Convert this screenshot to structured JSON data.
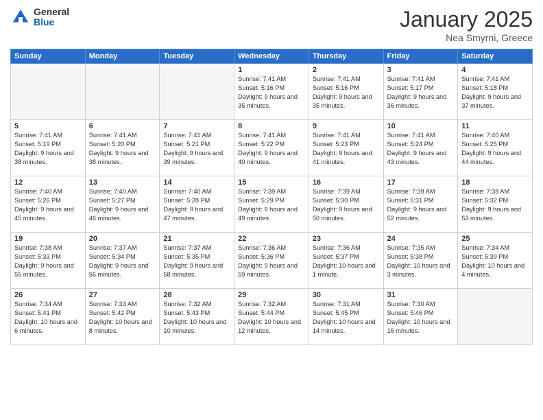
{
  "header": {
    "logo_general": "General",
    "logo_blue": "Blue",
    "title": "January 2025",
    "subtitle": "Nea Smyrni, Greece"
  },
  "days_of_week": [
    "Sunday",
    "Monday",
    "Tuesday",
    "Wednesday",
    "Thursday",
    "Friday",
    "Saturday"
  ],
  "weeks": [
    [
      {
        "day": "",
        "info": ""
      },
      {
        "day": "",
        "info": ""
      },
      {
        "day": "",
        "info": ""
      },
      {
        "day": "1",
        "info": "Sunrise: 7:41 AM\nSunset: 5:16 PM\nDaylight: 9 hours and 35 minutes."
      },
      {
        "day": "2",
        "info": "Sunrise: 7:41 AM\nSunset: 5:16 PM\nDaylight: 9 hours and 35 minutes."
      },
      {
        "day": "3",
        "info": "Sunrise: 7:41 AM\nSunset: 5:17 PM\nDaylight: 9 hours and 36 minutes."
      },
      {
        "day": "4",
        "info": "Sunrise: 7:41 AM\nSunset: 5:18 PM\nDaylight: 9 hours and 37 minutes."
      }
    ],
    [
      {
        "day": "5",
        "info": "Sunrise: 7:41 AM\nSunset: 5:19 PM\nDaylight: 9 hours and 38 minutes."
      },
      {
        "day": "6",
        "info": "Sunrise: 7:41 AM\nSunset: 5:20 PM\nDaylight: 9 hours and 38 minutes."
      },
      {
        "day": "7",
        "info": "Sunrise: 7:41 AM\nSunset: 5:21 PM\nDaylight: 9 hours and 39 minutes."
      },
      {
        "day": "8",
        "info": "Sunrise: 7:41 AM\nSunset: 5:22 PM\nDaylight: 9 hours and 40 minutes."
      },
      {
        "day": "9",
        "info": "Sunrise: 7:41 AM\nSunset: 5:23 PM\nDaylight: 9 hours and 41 minutes."
      },
      {
        "day": "10",
        "info": "Sunrise: 7:41 AM\nSunset: 5:24 PM\nDaylight: 9 hours and 43 minutes."
      },
      {
        "day": "11",
        "info": "Sunrise: 7:40 AM\nSunset: 5:25 PM\nDaylight: 9 hours and 44 minutes."
      }
    ],
    [
      {
        "day": "12",
        "info": "Sunrise: 7:40 AM\nSunset: 5:26 PM\nDaylight: 9 hours and 45 minutes."
      },
      {
        "day": "13",
        "info": "Sunrise: 7:40 AM\nSunset: 5:27 PM\nDaylight: 9 hours and 46 minutes."
      },
      {
        "day": "14",
        "info": "Sunrise: 7:40 AM\nSunset: 5:28 PM\nDaylight: 9 hours and 47 minutes."
      },
      {
        "day": "15",
        "info": "Sunrise: 7:39 AM\nSunset: 5:29 PM\nDaylight: 9 hours and 49 minutes."
      },
      {
        "day": "16",
        "info": "Sunrise: 7:39 AM\nSunset: 5:30 PM\nDaylight: 9 hours and 50 minutes."
      },
      {
        "day": "17",
        "info": "Sunrise: 7:39 AM\nSunset: 5:31 PM\nDaylight: 9 hours and 52 minutes."
      },
      {
        "day": "18",
        "info": "Sunrise: 7:38 AM\nSunset: 5:32 PM\nDaylight: 9 hours and 53 minutes."
      }
    ],
    [
      {
        "day": "19",
        "info": "Sunrise: 7:38 AM\nSunset: 5:33 PM\nDaylight: 9 hours and 55 minutes."
      },
      {
        "day": "20",
        "info": "Sunrise: 7:37 AM\nSunset: 5:34 PM\nDaylight: 9 hours and 56 minutes."
      },
      {
        "day": "21",
        "info": "Sunrise: 7:37 AM\nSunset: 5:35 PM\nDaylight: 9 hours and 58 minutes."
      },
      {
        "day": "22",
        "info": "Sunrise: 7:36 AM\nSunset: 5:36 PM\nDaylight: 9 hours and 59 minutes."
      },
      {
        "day": "23",
        "info": "Sunrise: 7:36 AM\nSunset: 5:37 PM\nDaylight: 10 hours and 1 minute."
      },
      {
        "day": "24",
        "info": "Sunrise: 7:35 AM\nSunset: 5:38 PM\nDaylight: 10 hours and 3 minutes."
      },
      {
        "day": "25",
        "info": "Sunrise: 7:34 AM\nSunset: 5:39 PM\nDaylight: 10 hours and 4 minutes."
      }
    ],
    [
      {
        "day": "26",
        "info": "Sunrise: 7:34 AM\nSunset: 5:41 PM\nDaylight: 10 hours and 6 minutes."
      },
      {
        "day": "27",
        "info": "Sunrise: 7:33 AM\nSunset: 5:42 PM\nDaylight: 10 hours and 8 minutes."
      },
      {
        "day": "28",
        "info": "Sunrise: 7:32 AM\nSunset: 5:43 PM\nDaylight: 10 hours and 10 minutes."
      },
      {
        "day": "29",
        "info": "Sunrise: 7:32 AM\nSunset: 5:44 PM\nDaylight: 10 hours and 12 minutes."
      },
      {
        "day": "30",
        "info": "Sunrise: 7:31 AM\nSunset: 5:45 PM\nDaylight: 10 hours and 14 minutes."
      },
      {
        "day": "31",
        "info": "Sunrise: 7:30 AM\nSunset: 5:46 PM\nDaylight: 10 hours and 16 minutes."
      },
      {
        "day": "",
        "info": ""
      }
    ]
  ]
}
